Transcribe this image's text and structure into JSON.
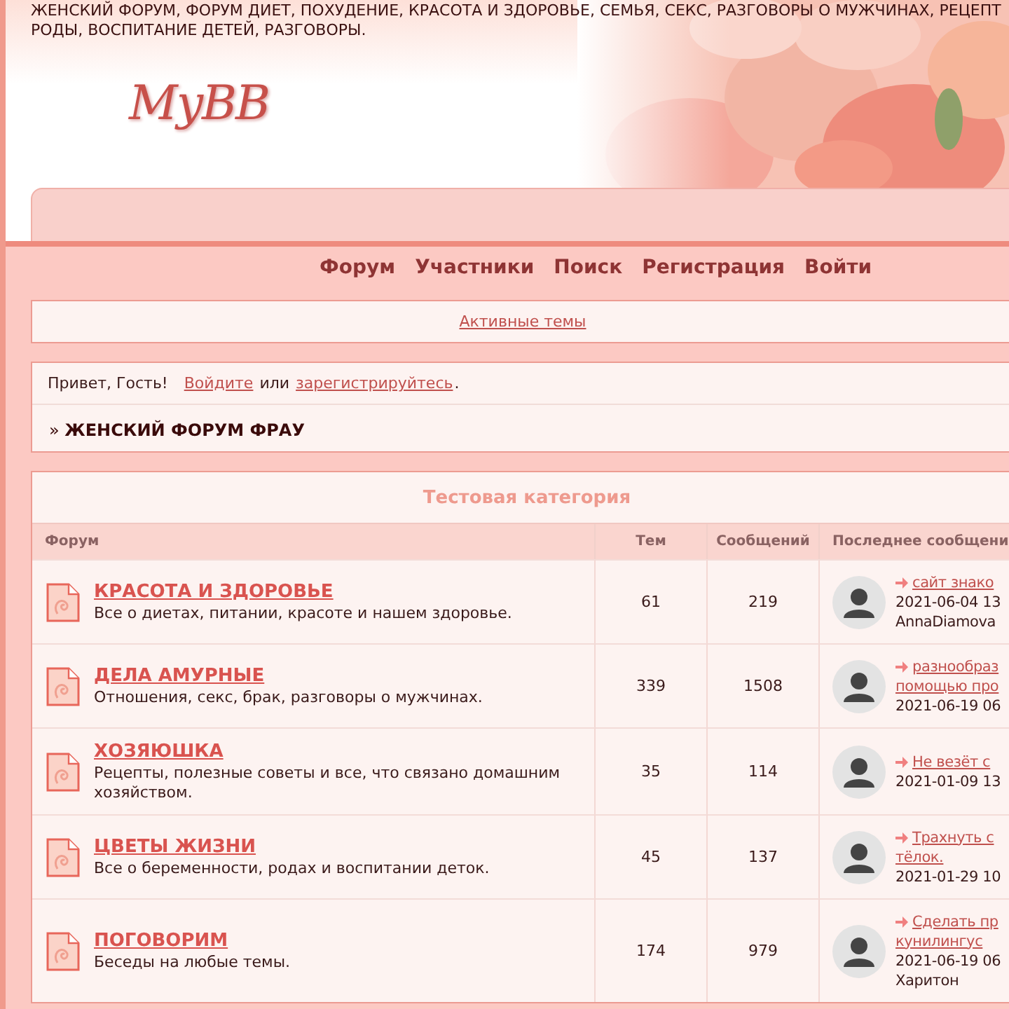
{
  "header": {
    "tagline_lines": [
      "ЖЕНСКИЙ ФОРУМ, ФОРУМ ДИЕТ, ПОХУДЕНИЕ, КРАСОТА И ЗДОРОВЬЕ, СЕМЬЯ, СЕКС, РАЗГОВОРЫ О МУЖЧИНАХ, РЕЦЕПТ",
      "РОДЫ, ВОСПИТАНИЕ ДЕТЕЙ, РАЗГОВОРЫ."
    ],
    "logo": "MyBB"
  },
  "nav": [
    {
      "label": "Форум"
    },
    {
      "label": "Участники"
    },
    {
      "label": "Поиск"
    },
    {
      "label": "Регистрация"
    },
    {
      "label": "Войти"
    }
  ],
  "active_topics_link": "Активные темы",
  "welcome": {
    "greeting": "Привет, Гость!",
    "login_link": "Войдите",
    "joiner": "или",
    "register_link": "зарегистрируйтесь",
    "end": "."
  },
  "breadcrumb": "» **ЖЕНСКИЙ ФОРУМ ФРАУ**",
  "category": {
    "title": "Тестовая категория",
    "columns": [
      "Форум",
      "Тем",
      "Сообщений",
      "Последнее сообщени"
    ],
    "forums": [
      {
        "name": "КРАСОТА И ЗДОРОВЬЕ",
        "description": "Все о диетах, питании, красоте и нашем здоровье.",
        "topics": "61",
        "posts": "219",
        "last_post": {
          "topic_lines": [
            "сайт знако"
          ],
          "date": "2021-06-04 13",
          "author": "AnnaDiamova"
        }
      },
      {
        "name": "ДЕЛА АМУРНЫЕ",
        "description": "Отношения, секс, брак, разговоры о мужчинах.",
        "topics": "339",
        "posts": "1508",
        "last_post": {
          "topic_lines": [
            "разнообраз",
            "помощью про"
          ],
          "date": "2021-06-19 06"
        }
      },
      {
        "name": "ХОЗЯЮШКА",
        "description": "Рецепты, полезные советы и все, что связано домашним хозяйством.",
        "topics": "35",
        "posts": "114",
        "last_post": {
          "topic_lines": [
            "Не везёт с"
          ],
          "date": "2021-01-09 13"
        }
      },
      {
        "name": "ЦВЕТЫ ЖИЗНИ",
        "description": "Все о беременности, родах и воспитании деток.",
        "topics": "45",
        "posts": "137",
        "last_post": {
          "topic_lines": [
            "Трахнуть с",
            "тёлок."
          ],
          "date": "2021-01-29 10"
        }
      },
      {
        "name": "ПОГОВОРИМ",
        "description": "Беседы на любые темы.",
        "topics": "174",
        "posts": "979",
        "last_post": {
          "topic_lines": [
            "Сделать пр",
            "кунилингус"
          ],
          "date": "2021-06-19 06",
          "author": "Харитон"
        }
      }
    ]
  }
}
